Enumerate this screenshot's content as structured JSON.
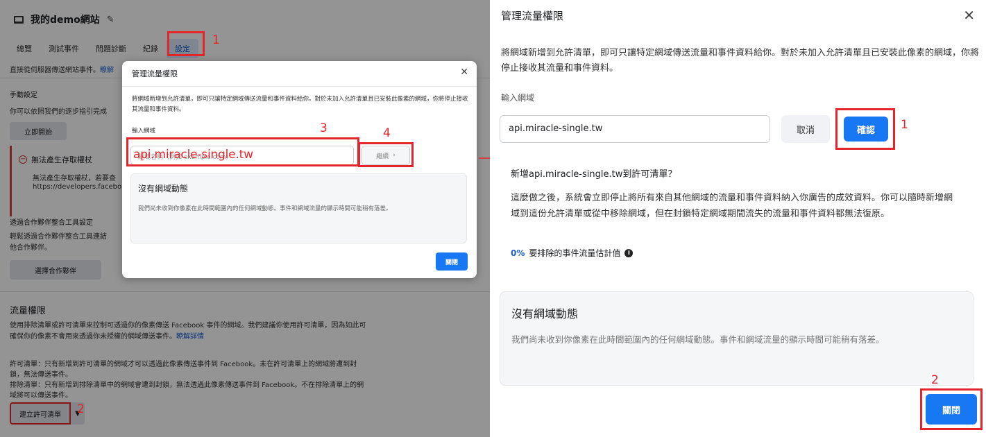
{
  "background": {
    "site_title": "我的demo網站",
    "tabs": [
      {
        "label": "總覽"
      },
      {
        "label": "測試事件"
      },
      {
        "label": "問題診斷"
      },
      {
        "label": "紀錄"
      },
      {
        "label": "設定"
      }
    ],
    "server_text": "直接從伺服器傳送網站事件。",
    "server_link": "瞭解",
    "manual_heading": "手動設定",
    "manual_text": "你可以依照我們的逐步指引完成",
    "start_button": "立即開始",
    "alert": {
      "title": "無法產生存取權杖",
      "text1": "無法產生存取權杖，若要查",
      "text2": "https://developers.facebo"
    },
    "partner_heading": "透過合作夥伴整合工具設定",
    "partner_text1": "輕鬆透過合作夥伴整合工具連結",
    "partner_text2": "他合作夥伴。",
    "partner_button": "選擇合作夥伴",
    "traffic": {
      "title": "流量權限",
      "desc1": "使用排除清單或許可清單來控制可透過你的像素傳送 Facebook 事件的網域。我們建議你使用許可清單，因為如此可",
      "desc2": "確保你的像素不會用來透過你未授權的網域傳送事件。",
      "desc_link": "瞭解詳情",
      "allow1": "許可清單：只有新增到許可清單的網域才可以透過此像素傳送事件到 Facebook。未在許可清單上的網域將遭到封",
      "allow2": "鎖，無法傳送事件。",
      "block1": "排除清單：只有新增到排除清單中的網域會遭到封鎖，無法透過此像素傳送事件到 Facebook。不在排除清單上的網",
      "block2": "域將可以傳送事件。",
      "create_button": "建立許可清單"
    }
  },
  "small_modal": {
    "title": "管理流量權限",
    "description": "將網域新增到允許清單，即可只讓特定網域傳送流量和事件資料給你。對於未加入允許清單且已安裝此像素的網域，你將停止接收其流量和事件資料。",
    "input_label": "輸入網域",
    "input_placeholder": "網域名稱（例如 example.com）",
    "input_overlay": "api.miracle-single.tw",
    "continue_button": "繼續",
    "card_title": "沒有網域動態",
    "card_text": "我們尚未收到你像素在此時間範圍內的任何網域動態。事件和網域流量的顯示時間可能稍有落差。",
    "close_button": "關閉"
  },
  "right_panel": {
    "title": "管理流量權限",
    "description": "將網域新增到允許清單，即可只讓特定網域傳送流量和事件資料給你。對於未加入允許清單且已安裝此像素的網域，你將停止接收其流量和事件資料。",
    "input_label": "輸入網域",
    "input_value": "api.miracle-single.tw",
    "cancel_button": "取消",
    "confirm_button": "確認",
    "add_title": "新增api.miracle-single.tw到許可清單？",
    "add_description": "這麼做之後，系統會立即停止將所有來自其他網域的流量和事件資料納入你廣告的成效資料。你可以隨時新增網域到這份允許清單或從中移除網域，但在封鎖特定網域期間流失的流量和事件資料都無法復原。",
    "estimate_percent": "0%",
    "estimate_label": "要排除的事件流量估計值",
    "card_title": "沒有網域動態",
    "card_text": "我們尚未收到你像素在此時間範圍內的任何網域動態。事件和網域流量的顯示時間可能稍有落差。",
    "close_button": "關閉"
  },
  "annotations": {
    "settings_tab": "1",
    "create_button": "2",
    "input": "3",
    "continue": "4",
    "confirm": "1",
    "close": "2"
  },
  "colors": {
    "accent": "#1877f2",
    "annotation": "#e4262c"
  }
}
